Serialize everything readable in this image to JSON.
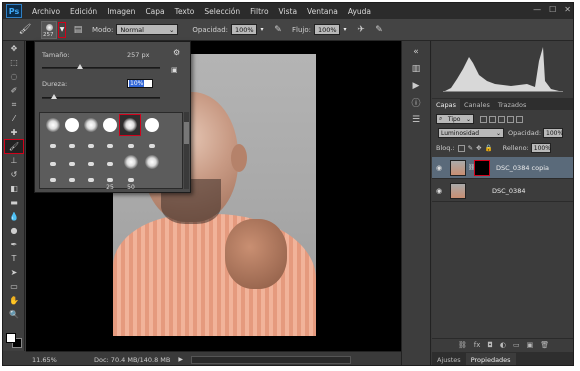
{
  "app": {
    "logo": "Ps"
  },
  "menu": [
    "Archivo",
    "Edición",
    "Imagen",
    "Capa",
    "Texto",
    "Selección",
    "Filtro",
    "Vista",
    "Ventana",
    "Ayuda"
  ],
  "window_controls": {
    "minimize": "—",
    "maximize": "☐",
    "close": "✕"
  },
  "options": {
    "brush_size": "257",
    "mode_label": "Modo:",
    "mode_value": "Normal",
    "opacity_label": "Opacidad:",
    "opacity_value": "100%",
    "flow_label": "Flujo:",
    "flow_value": "100%"
  },
  "brush_panel": {
    "size_label": "Tamaño:",
    "size_value": "257 px",
    "size_level_pct": 32,
    "hardness_label": "Dureza:",
    "hardness_value": "10%",
    "hardness_level_pct": 10,
    "brush_numbers": [
      "25",
      "50"
    ]
  },
  "status": {
    "zoom": "11.65%",
    "doc": "Doc: 70.4 MB/140.8 MB"
  },
  "layers_panel": {
    "tabs": [
      "Capas",
      "Canales",
      "Trazados"
    ],
    "filter_value": "Tipo",
    "blend_value": "Luminosidad",
    "opacity_label": "Opacidad:",
    "opacity_value": "100%",
    "lock_label": "Bloq.:",
    "fill_label": "Relleno:",
    "fill_value": "100%",
    "layers": [
      {
        "name": "DSC_0384 copia"
      },
      {
        "name": "DSC_0384"
      }
    ],
    "bottom_tabs": [
      "Ajustes",
      "Propiedades"
    ]
  }
}
